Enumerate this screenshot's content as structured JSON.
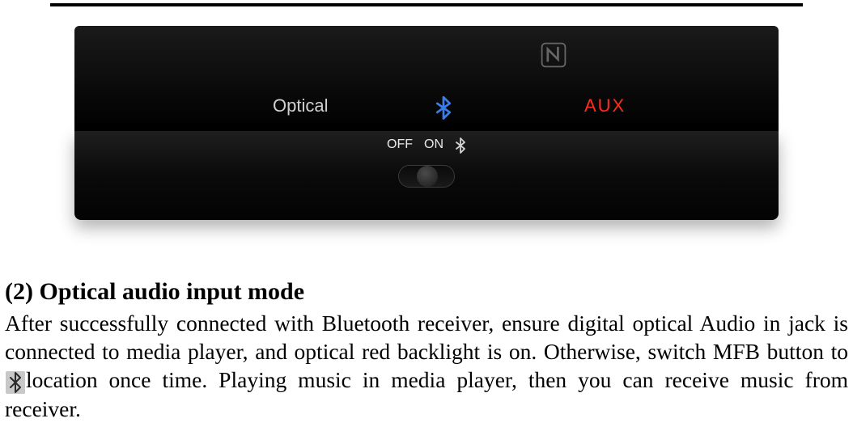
{
  "figure": {
    "opticalLabel": "Optical",
    "auxLabel": "AUX",
    "switch": {
      "offLabel": "OFF",
      "onLabel": "ON"
    }
  },
  "section": {
    "heading": "(2) Optical audio input mode",
    "body_part1": "After successfully connected with Bluetooth receiver, ensure digital optical Audio in jack is connected to media player, and optical red backlight is on. Otherwise, switch MFB button to ",
    "body_part2": "location once time. Playing music in media player, then you can receive music from receiver."
  }
}
